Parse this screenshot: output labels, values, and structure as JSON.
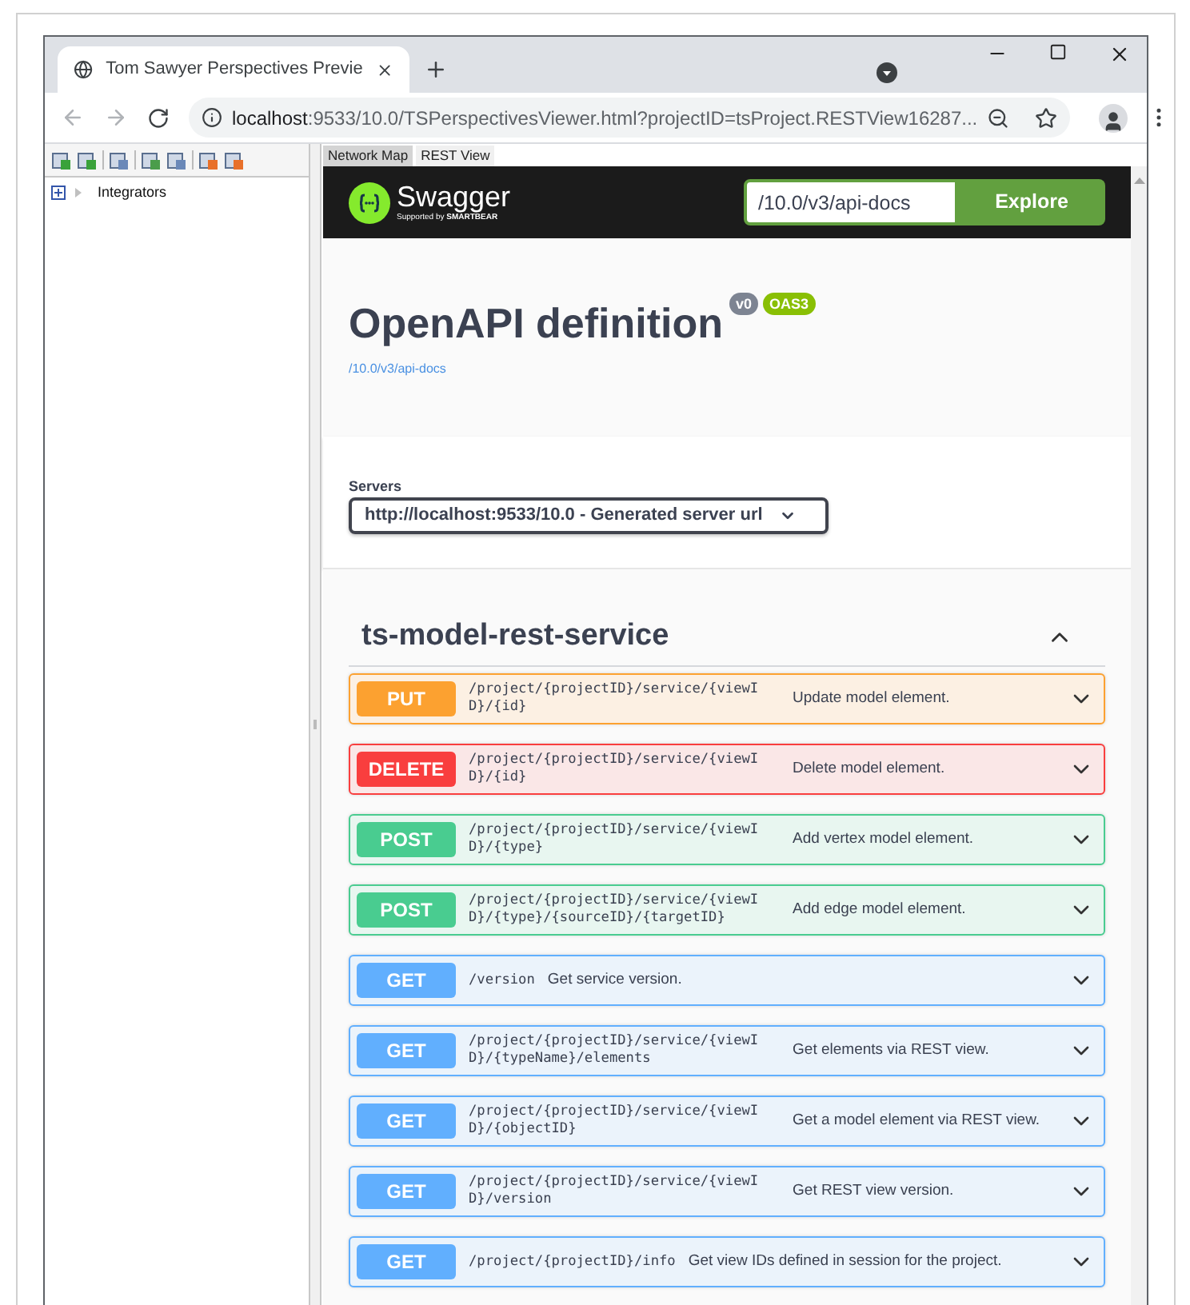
{
  "browser": {
    "tab_title": "Tom Sawyer Perspectives Previe",
    "url_host": "localhost",
    "url_rest": ":9533/10.0/TSPerspectivesViewer.html?projectID=tsProject.RESTView16287..."
  },
  "sidebar": {
    "tree": [
      {
        "label": "Integrators",
        "expanded": false
      }
    ]
  },
  "view_tabs": [
    {
      "label": "Network Map",
      "selected": false
    },
    {
      "label": "REST View",
      "selected": true
    }
  ],
  "swagger": {
    "logo": "Swagger",
    "tagline": "Supported by **SMARTBEAR**",
    "url_field": "/10.0/v3/api-docs",
    "explore": "Explore"
  },
  "info": {
    "title": "OpenAPI definition",
    "version": "v0",
    "oas": "OAS3",
    "link": "/10.0/v3/api-docs"
  },
  "servers": {
    "label": "Servers",
    "value": "http://localhost:9533/10.0 - Generated server url"
  },
  "tag": {
    "name": "ts-model-rest-service",
    "expanded": true
  },
  "operations": [
    {
      "kind": "put",
      "method": "PUT",
      "path": "/project/{projectID}/service/{viewID}/{id}",
      "summary": "Update model element."
    },
    {
      "kind": "delete",
      "method": "DELETE",
      "path": "/project/{projectID}/service/{viewID}/{id}",
      "summary": "Delete model element."
    },
    {
      "kind": "post",
      "method": "POST",
      "path": "/project/{projectID}/service/{viewID}/{type}",
      "summary": "Add vertex model element."
    },
    {
      "kind": "post",
      "method": "POST",
      "path": "/project/{projectID}/service/{viewID}/{type}/{sourceID}/{targetID}",
      "summary": "Add edge model element."
    },
    {
      "kind": "get",
      "method": "GET",
      "path": "/version",
      "summary": "Get service version."
    },
    {
      "kind": "get",
      "method": "GET",
      "path": "/project/{projectID}/service/{viewID}/{typeName}/elements",
      "summary": "Get elements via REST view."
    },
    {
      "kind": "get",
      "method": "GET",
      "path": "/project/{projectID}/service/{viewID}/{objectID}",
      "summary": "Get a model element via REST view."
    },
    {
      "kind": "get",
      "method": "GET",
      "path": "/project/{projectID}/service/{viewID}/version",
      "summary": "Get REST view version."
    },
    {
      "kind": "get",
      "method": "GET",
      "path": "/project/{projectID}/info",
      "summary": "Get view IDs defined in session for the project."
    }
  ]
}
